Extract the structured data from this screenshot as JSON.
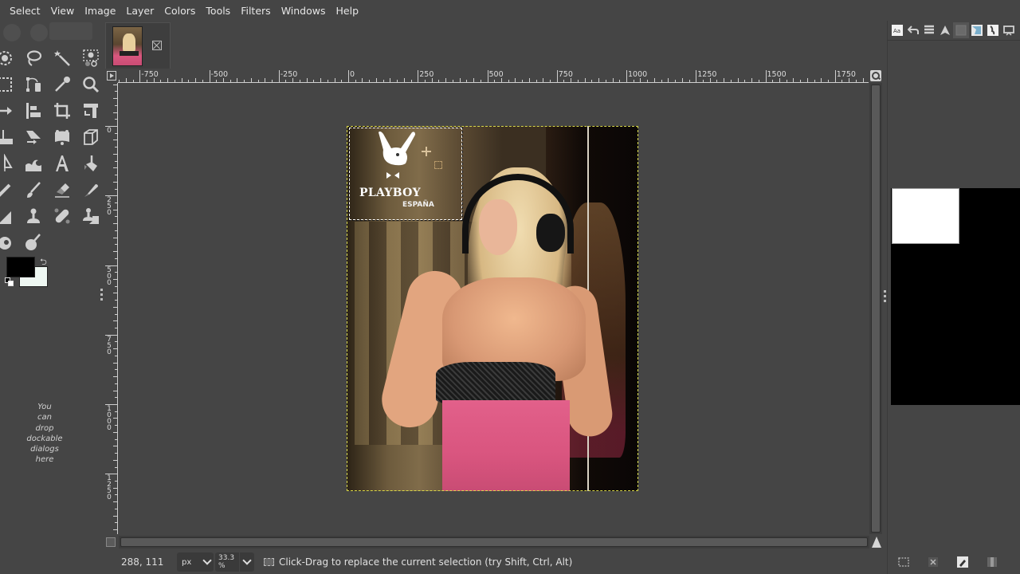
{
  "menubar": {
    "items": [
      "Select",
      "View",
      "Image",
      "Layer",
      "Colors",
      "Tools",
      "Filters",
      "Windows",
      "Help"
    ]
  },
  "toolbox": {
    "tools": [
      {
        "name": "ellipse-select-tool"
      },
      {
        "name": "free-select-tool"
      },
      {
        "name": "fuzzy-select-tool"
      },
      {
        "name": "select-by-color-tool"
      },
      {
        "name": "rect-select-tool"
      },
      {
        "name": "paths-tool"
      },
      {
        "name": "color-picker-tool"
      },
      {
        "name": "zoom-tool"
      },
      {
        "name": "move-tool"
      },
      {
        "name": "align-tool"
      },
      {
        "name": "crop-tool"
      },
      {
        "name": "unified-transform-tool"
      },
      {
        "name": "scale-tool"
      },
      {
        "name": "shear-tool"
      },
      {
        "name": "cage-transform-tool"
      },
      {
        "name": "perspective-tool"
      },
      {
        "name": "flip-tool"
      },
      {
        "name": "warp-transform-tool"
      },
      {
        "name": "text-tool"
      },
      {
        "name": "bucket-fill-tool"
      },
      {
        "name": "pencil-tool"
      },
      {
        "name": "paintbrush-tool"
      },
      {
        "name": "eraser-tool"
      },
      {
        "name": "ink-tool"
      },
      {
        "name": "airbrush-tool"
      },
      {
        "name": "clone-tool"
      },
      {
        "name": "heal-tool"
      },
      {
        "name": "perspective-clone-tool"
      },
      {
        "name": "smudge-tool"
      },
      {
        "name": "dodge-burn-tool"
      }
    ],
    "foreground_color": "#000000",
    "background_color": "#eef7f2",
    "drop_hint": [
      "You",
      "can",
      "drop",
      "dockable",
      "dialogs",
      "here"
    ]
  },
  "image_tab": {
    "thumbnail": "image-thumbnail",
    "close_icon": "close-icon"
  },
  "rulers": {
    "horizontal": [
      {
        "label": "-750",
        "value": -750
      },
      {
        "label": "-500",
        "value": -500
      },
      {
        "label": "-250",
        "value": -250
      },
      {
        "label": "0",
        "value": 0
      },
      {
        "label": "250",
        "value": 250
      },
      {
        "label": "500",
        "value": 500
      },
      {
        "label": "750",
        "value": 750
      },
      {
        "label": "1000",
        "value": 1000
      },
      {
        "label": "1250",
        "value": 1250
      },
      {
        "label": "1500",
        "value": 1500
      },
      {
        "label": "1750",
        "value": 1750
      }
    ],
    "vertical": [
      {
        "label": "0",
        "value": 0
      },
      {
        "label": "250",
        "value": 250
      },
      {
        "label": "500",
        "value": 500
      },
      {
        "label": "750",
        "value": 750
      },
      {
        "label": "1000",
        "value": 1000
      },
      {
        "label": "1250",
        "value": 1250
      }
    ]
  },
  "canvas": {
    "logo_brand": "PLAYBOY",
    "logo_sub": "ESPAÑA"
  },
  "statusbar": {
    "coords": "288, 111",
    "unit": "px",
    "zoom": "33.3 %",
    "message": "Click-Drag to replace the current selection (try Shift, Ctrl, Alt)"
  },
  "dock": {
    "tabs": [
      "fonts-tab",
      "undo-history-tab",
      "layers-tab",
      "paths-tab",
      "channels-tab",
      "images-tab",
      "brushes-tab",
      "device-status-tab"
    ],
    "bottom_buttons": [
      "selection-to-path-button",
      "clear-button",
      "edit-button",
      "save-button"
    ]
  }
}
